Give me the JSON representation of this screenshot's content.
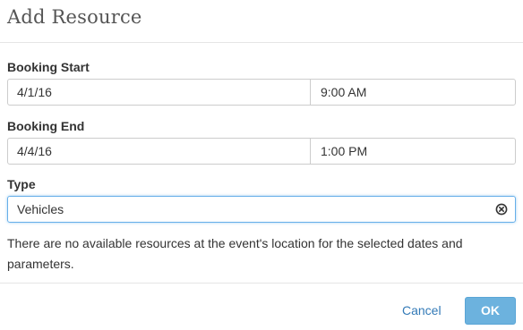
{
  "dialog": {
    "title": "Add Resource"
  },
  "booking_start": {
    "label": "Booking Start",
    "date": "4/1/16",
    "time": "9:00 AM"
  },
  "booking_end": {
    "label": "Booking End",
    "date": "4/4/16",
    "time": "1:00 PM"
  },
  "type": {
    "label": "Type",
    "value": "Vehicles",
    "clear_icon": "clear-circle-x-icon"
  },
  "message": "There are no available resources at the event's location for the selected dates and parameters.",
  "footer": {
    "cancel_label": "Cancel",
    "ok_label": "OK"
  },
  "colors": {
    "link": "#337ab7",
    "primary_button": "#6cb2de",
    "focus_border": "#66afe9"
  }
}
